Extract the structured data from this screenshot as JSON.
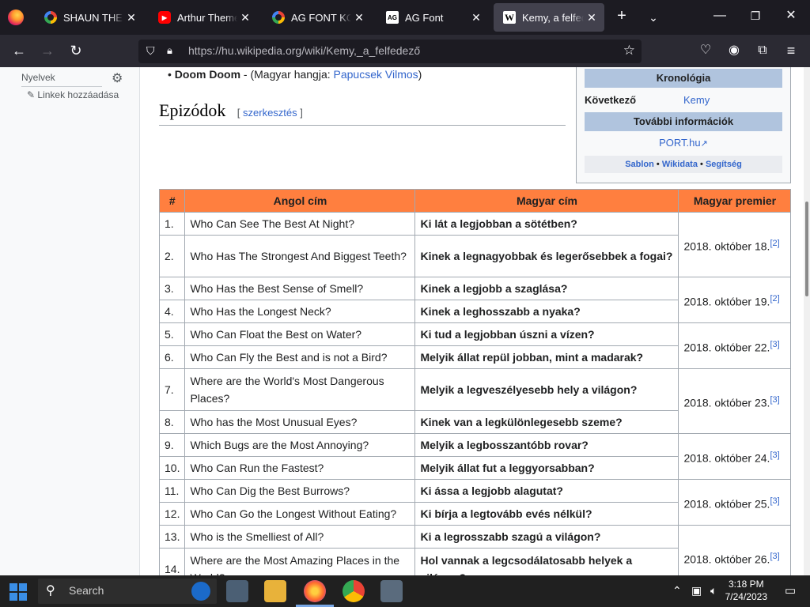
{
  "browser": {
    "tabs": [
      {
        "title": "SHAUN THE SHE",
        "favicon": "google-icon"
      },
      {
        "title": "Arthur Theme So",
        "favicon": "youtube-icon"
      },
      {
        "title": "AG FONT KOREA",
        "favicon": "google-icon"
      },
      {
        "title": "AG Font",
        "favicon": "ag-font-icon"
      },
      {
        "title": "Kemy, a felfedez",
        "favicon": "wikipedia-icon",
        "active": true
      }
    ],
    "url": "https://hu.wikipedia.org/wiki/Kemy,_a_felfedező"
  },
  "sidebar": {
    "languages_label": "Nyelvek",
    "add_links": "Linkek hozzáadása"
  },
  "content": {
    "bullet_name": "Doom Doom",
    "bullet_middle": " - (Magyar hangja: ",
    "bullet_link": "Papucsek Vilmos",
    "bullet_end": ")",
    "section_heading": "Epizódok",
    "edit_open": "[ ",
    "edit_link": "szerkesztés",
    "edit_close": " ]"
  },
  "infobox": {
    "chronology_header": "Kronológia",
    "next_label": "Következő",
    "next_value": "Kemy",
    "more_info_header": "További információk",
    "port_link": "PORT.hu",
    "footer_sablon": "Sablon",
    "footer_wikidata": "Wikidata",
    "footer_help": "Segítség",
    "footer_sep": " • "
  },
  "table": {
    "headers": [
      "#",
      "Angol cím",
      "Magyar cím",
      "Magyar premier"
    ],
    "rows": [
      {
        "num": "1.",
        "en": "Who Can See The Best At Night?",
        "hu": "Ki lát a legjobban a sötétben?"
      },
      {
        "num": "2.",
        "en": "Who Has The Strongest And Biggest Teeth?",
        "hu": "Kinek a legnagyobbak és legerősebbek a fogai?"
      },
      {
        "num": "3.",
        "en": "Who Has the Best Sense of Smell?",
        "hu": "Kinek a legjobb a szaglása?"
      },
      {
        "num": "4.",
        "en": "Who Has the Longest Neck?",
        "hu": "Kinek a leghosszabb a nyaka?"
      },
      {
        "num": "5.",
        "en": "Who Can Float the Best on Water?",
        "hu": "Ki tud a legjobban úszni a vízen?"
      },
      {
        "num": "6.",
        "en": "Who Can Fly the Best and is not a Bird?",
        "hu": "Melyik állat repül jobban, mint a madarak?"
      },
      {
        "num": "7.",
        "en": "Where are the World's Most Dangerous Places?",
        "hu": "Melyik a legveszélyesebb hely a világon?"
      },
      {
        "num": "8.",
        "en": "Who has the Most Unusual Eyes?",
        "hu": "Kinek van a legkülönlegesebb szeme?"
      },
      {
        "num": "9.",
        "en": "Which Bugs are the Most Annoying?",
        "hu": "Melyik a legbosszantóbb rovar?"
      },
      {
        "num": "10.",
        "en": "Who Can Run the Fastest?",
        "hu": "Melyik állat fut a leggyorsabban?"
      },
      {
        "num": "11.",
        "en": "Who Can Dig the Best Burrows?",
        "hu": "Ki ássa a legjobb alagutat?"
      },
      {
        "num": "12.",
        "en": "Who Can Go the Longest Without Eating?",
        "hu": "Ki bírja a legtovább evés nélkül?"
      },
      {
        "num": "13.",
        "en": "Who is the Smelliest of All?",
        "hu": "Ki a legrosszabb szagú a világon?"
      },
      {
        "num": "14.",
        "en": "Where are the Most Amazing Places in the World?",
        "hu": "Hol vannak a legcsodálatosabb helyek a világon?"
      }
    ],
    "premieres": [
      {
        "date": "2018. október 18.",
        "ref": "[2]"
      },
      {
        "date": "2018. október 19.",
        "ref": "[2]"
      },
      {
        "date": "2018. október 22.",
        "ref": "[3]"
      },
      {
        "date": "2018. október 23.",
        "ref": "[3]"
      },
      {
        "date": "2018. október 24.",
        "ref": "[3]"
      },
      {
        "date": "2018. október 25.",
        "ref": "[3]"
      },
      {
        "date": "2018. október 26.",
        "ref": "[3]"
      }
    ]
  },
  "taskbar": {
    "search_placeholder": "Search",
    "time": "3:18 PM",
    "date": "7/24/2023"
  },
  "colors": {
    "table_header": "#ff7f3f",
    "infobox_header": "#b0c4de",
    "link": "#3366cc"
  }
}
